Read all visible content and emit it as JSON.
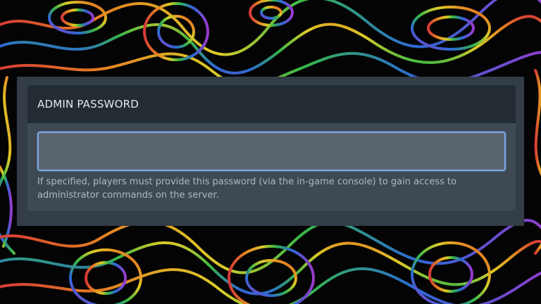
{
  "field": {
    "title": "ADMIN PASSWORD",
    "value": "",
    "placeholder": "",
    "help_text": "If specified, players must provide this password (via the in-game console) to gain access to administrator commands on the server."
  },
  "theme": {
    "input_focus_color": "#7fa8e6",
    "card_color": "#3e4954",
    "header_color": "#232b33"
  }
}
